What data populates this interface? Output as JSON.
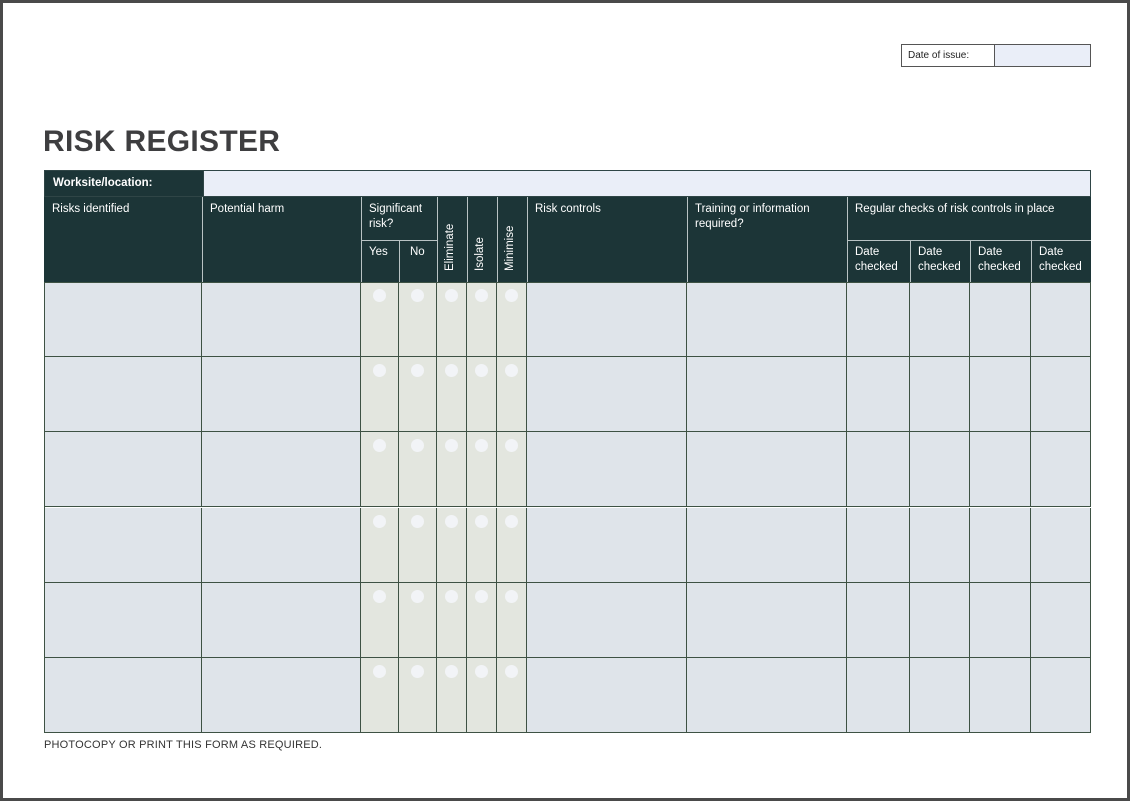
{
  "form": {
    "title": "RISK REGISTER",
    "date_of_issue_label": "Date of issue:",
    "date_of_issue_value": "",
    "worksite_label": "Worksite/location:",
    "worksite_value": "",
    "footer_note": "PHOTOCOPY OR PRINT THIS FORM AS REQUIRED."
  },
  "table": {
    "headers": {
      "risks_identified": "Risks identified",
      "potential_harm": "Potential harm",
      "significant_risk": "Significant risk?",
      "yes": "Yes",
      "no": "No",
      "eliminate": "Eliminate",
      "isolate": "Isolate",
      "minimise": "Minimise",
      "risk_controls": "Risk controls",
      "training": "Training or information required?",
      "regular_checks": "Regular checks of risk controls in place",
      "date_checked": [
        "Date checked",
        "Date checked",
        "Date checked",
        "Date checked"
      ]
    },
    "row_count": 6
  },
  "colors": {
    "header_bg": "#1c3537",
    "field_blue": "#dfe4ea",
    "field_grey": "#e3e6df",
    "input_blue": "#eaeef8"
  }
}
